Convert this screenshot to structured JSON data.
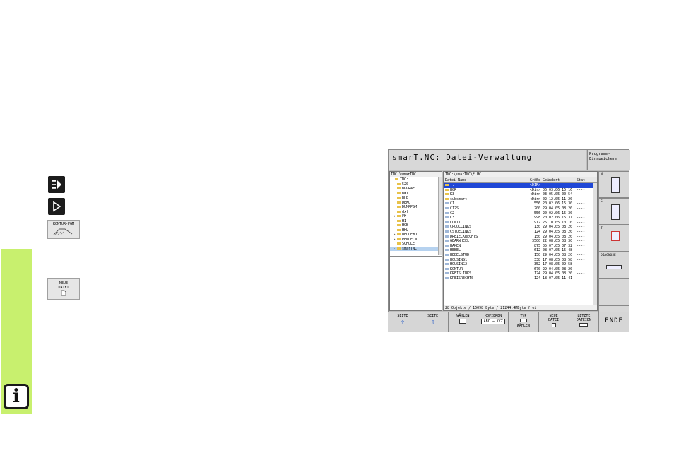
{
  "sidebar": {
    "info_glyph": "i",
    "keys": [
      {
        "icon": "program-edit-icon"
      },
      {
        "icon": "program-run-icon"
      }
    ],
    "softkeys": [
      {
        "label": "KONTUR-PGM"
      },
      {
        "label_line1": "NEUE",
        "label_line2": "DATEI"
      }
    ]
  },
  "screen": {
    "title": "smarT.NC: Datei-Verwaltung",
    "mode_line1": "Programm-",
    "mode_line2": "Einspeichern",
    "tree": {
      "path": "TNC:\\smarTNC",
      "items": [
        {
          "label": "TNC:",
          "expander": "",
          "selected": false
        },
        {
          "label": "520",
          "expander": "",
          "selected": false
        },
        {
          "label": "BGGRAF",
          "expander": "",
          "selected": false
        },
        {
          "label": "BWT",
          "expander": "",
          "selected": false
        },
        {
          "label": "BHB",
          "expander": "",
          "selected": false
        },
        {
          "label": "DEMO",
          "expander": "",
          "selected": false
        },
        {
          "label": "DUMPPGM",
          "expander": "",
          "selected": false
        },
        {
          "label": "dxf",
          "expander": "",
          "selected": false
        },
        {
          "label": "FK",
          "expander": "+",
          "selected": false
        },
        {
          "label": "H1",
          "expander": "",
          "selected": false
        },
        {
          "label": "HGB",
          "expander": "",
          "selected": false
        },
        {
          "label": "HHL",
          "expander": "",
          "selected": false
        },
        {
          "label": "NEUDEMO",
          "expander": "+",
          "selected": false
        },
        {
          "label": "PENDELN",
          "expander": "+",
          "selected": false
        },
        {
          "label": "SCHULE",
          "expander": "",
          "selected": false
        },
        {
          "label": "smarTNC",
          "expander": "-",
          "selected": true
        }
      ]
    },
    "files": {
      "path": "TNC:\\smarTNC\\*.HC",
      "columns": {
        "name": "Datei-Name",
        "size": "Größe",
        "date": "Geändert",
        "stat": "Stat"
      },
      "rows": [
        {
          "name": "..",
          "size": "<DIR>",
          "date": "",
          "stat": "",
          "dir": true,
          "selected": true
        },
        {
          "name": "HGR",
          "size": "<Dir>",
          "date": "06.03.06 15:16",
          "stat": "----",
          "dir": true,
          "selected": false
        },
        {
          "name": "K3",
          "size": "<Dir>",
          "date": "03.05.05 00:54",
          "stat": "----",
          "dir": true,
          "selected": false
        },
        {
          "name": "subsmart",
          "size": "<Dir>",
          "date": "02.12.05 11:20",
          "stat": "----",
          "dir": true,
          "selected": false
        },
        {
          "name": "C1",
          "size": "556",
          "date": "20.02.06 15:30",
          "stat": "----",
          "dir": false,
          "selected": false
        },
        {
          "name": "C12S",
          "size": "200",
          "date": "29.04.05 08:20",
          "stat": "----",
          "dir": false,
          "selected": false
        },
        {
          "name": "C2",
          "size": "556",
          "date": "20.02.06 15:30",
          "stat": "----",
          "dir": false,
          "selected": false
        },
        {
          "name": "C3",
          "size": "998",
          "date": "20.02.06 15:31",
          "stat": "----",
          "dir": false,
          "selected": false
        },
        {
          "name": "CONT1",
          "size": "912",
          "date": "25.10.05 10:10",
          "stat": "----",
          "dir": false,
          "selected": false
        },
        {
          "name": "CPOOLLINKS",
          "size": "130",
          "date": "29.04.05 08:20",
          "stat": "----",
          "dir": false,
          "selected": false
        },
        {
          "name": "CSTUELINKS",
          "size": "124",
          "date": "29.04.05 08:20",
          "stat": "----",
          "dir": false,
          "selected": false
        },
        {
          "name": "DREIECKRECHTS",
          "size": "150",
          "date": "29.04.05 08:20",
          "stat": "----",
          "dir": false,
          "selected": false
        },
        {
          "name": "GEARWHEEL",
          "size": "3500",
          "date": "22.08.05 08:30",
          "stat": "----",
          "dir": false,
          "selected": false
        },
        {
          "name": "HAKEN",
          "size": "875",
          "date": "05.07.05 07:32",
          "stat": "----",
          "dir": false,
          "selected": false
        },
        {
          "name": "HEBEL",
          "size": "612",
          "date": "08.07.05 15:48",
          "stat": "----",
          "dir": false,
          "selected": false
        },
        {
          "name": "HEBELSTUD",
          "size": "150",
          "date": "29.04.05 08:20",
          "stat": "----",
          "dir": false,
          "selected": false
        },
        {
          "name": "HOUSING1",
          "size": "338",
          "date": "17.08.05 08:58",
          "stat": "----",
          "dir": false,
          "selected": false
        },
        {
          "name": "HOUSING2",
          "size": "352",
          "date": "17.08.05 09:58",
          "stat": "----",
          "dir": false,
          "selected": false
        },
        {
          "name": "KONTUR",
          "size": "670",
          "date": "29.04.05 08:20",
          "stat": "----",
          "dir": false,
          "selected": false
        },
        {
          "name": "KREISLINKS",
          "size": "124",
          "date": "29.04.05 08:20",
          "stat": "----",
          "dir": false,
          "selected": false
        },
        {
          "name": "KREISRECHTS",
          "size": "124",
          "date": "18.07.05 11:41",
          "stat": "----",
          "dir": false,
          "selected": false
        }
      ],
      "footer": "28 Objekte / 15098 Byte / 21244.4MByte frei"
    },
    "side_buttons": [
      {
        "label": "M",
        "icon": "spindle-icon"
      },
      {
        "label": "S",
        "icon": "tool-icon"
      },
      {
        "label": "T",
        "icon": "tool-change-icon"
      },
      {
        "label": "DIAGNOSE",
        "icon": "diagnose-icon"
      },
      {
        "label": "",
        "icon": ""
      },
      {
        "label": "",
        "icon": ""
      }
    ],
    "softkeys": [
      {
        "line1": "SEITE",
        "line2": "",
        "icon": "arrow-up-icon",
        "glyph": "⇧"
      },
      {
        "line1": "SEITE",
        "line2": "",
        "icon": "arrow-down-icon",
        "glyph": "⇩"
      },
      {
        "line1": "WÄHLEN",
        "line2": "",
        "icon": "select-icon",
        "glyph": ""
      },
      {
        "line1": "KOPIEREN",
        "line2": "ABC → XYZ",
        "icon": "copy-icon",
        "glyph": ""
      },
      {
        "line1": "TYP",
        "line2": "WÄHLEN",
        "icon": "type-icon",
        "glyph": ""
      },
      {
        "line1": "NEUE",
        "line2": "DATEI",
        "icon": "new-file-icon",
        "glyph": ""
      },
      {
        "line1": "LETZTE",
        "line2": "DATEIEN",
        "icon": "recent-files-icon",
        "glyph": ""
      },
      {
        "line1": "ENDE",
        "line2": "",
        "icon": "",
        "glyph": ""
      }
    ]
  }
}
